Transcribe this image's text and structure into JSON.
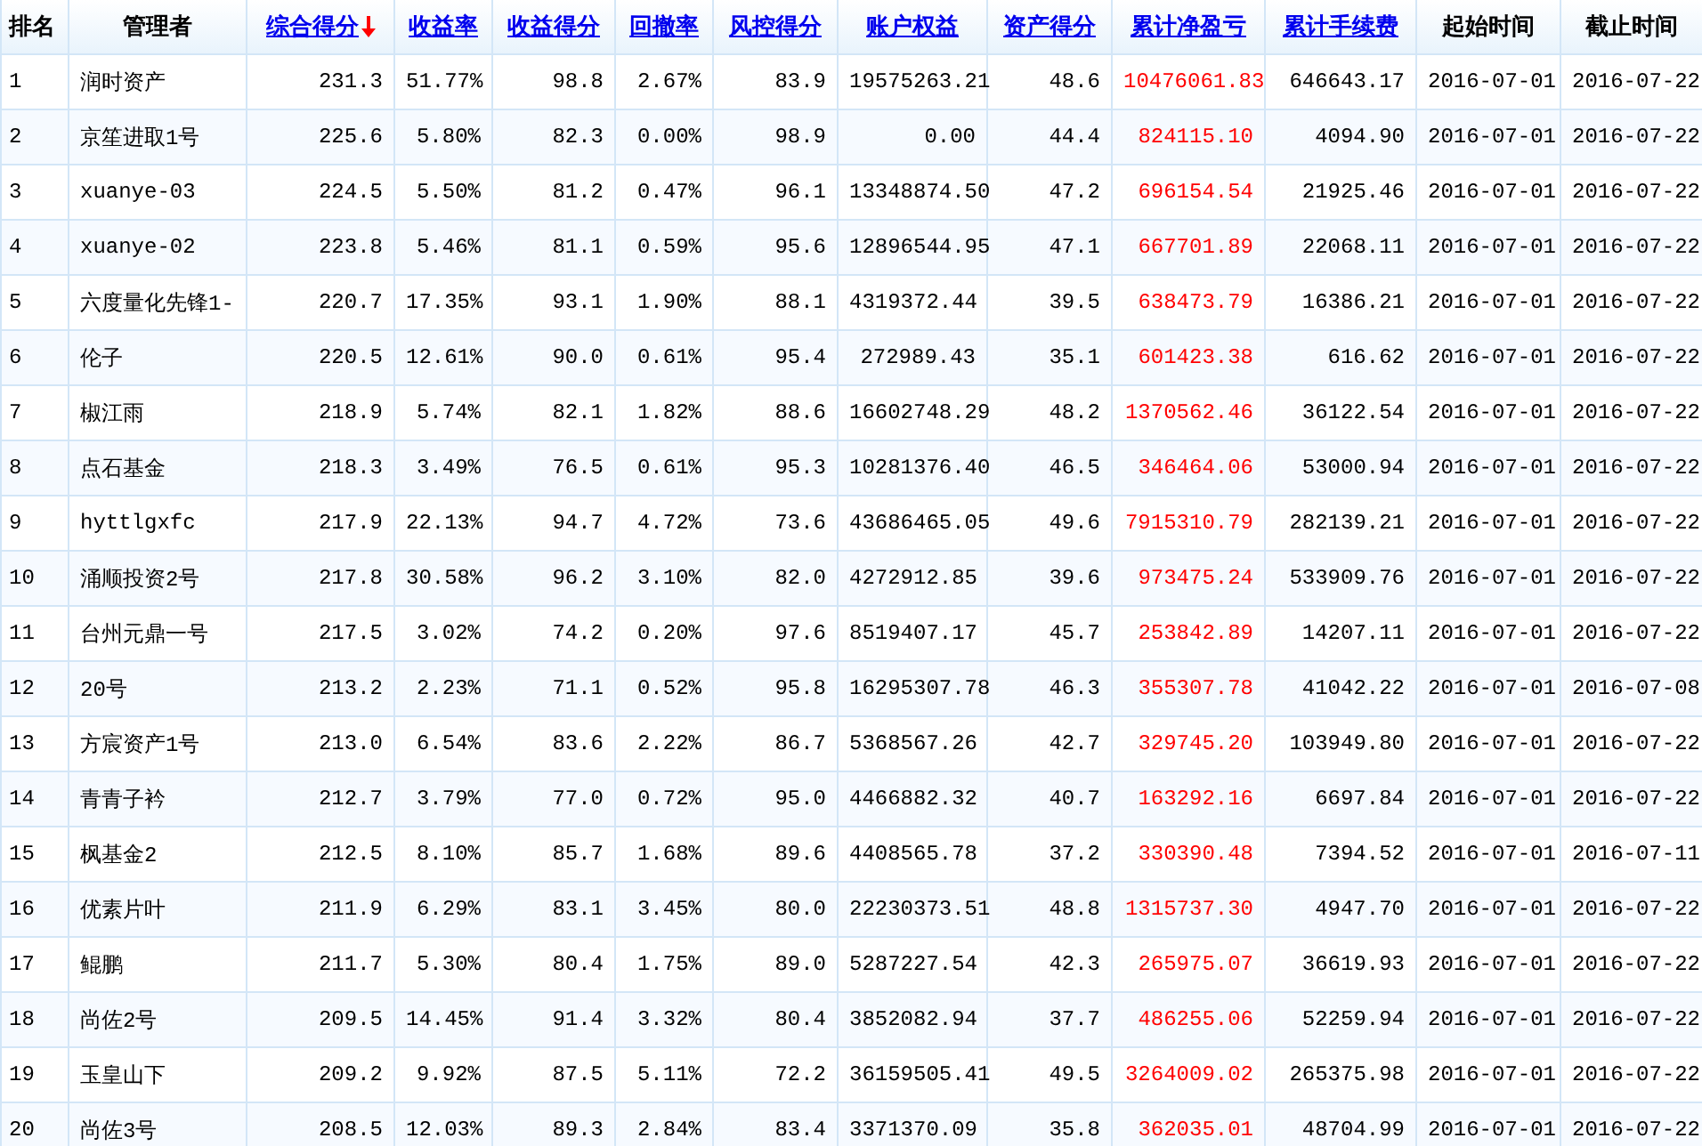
{
  "table": {
    "columns": [
      {
        "label": "排名",
        "kind": "rank",
        "link": false,
        "sorted": false,
        "highlight": false
      },
      {
        "label": "管理者",
        "kind": "text",
        "link": false,
        "sorted": false,
        "highlight": false
      },
      {
        "label": "综合得分",
        "kind": "number",
        "link": true,
        "sorted": true,
        "highlight": false
      },
      {
        "label": "收益率",
        "kind": "number",
        "link": true,
        "sorted": false,
        "highlight": false
      },
      {
        "label": "收益得分",
        "kind": "number",
        "link": true,
        "sorted": false,
        "highlight": false
      },
      {
        "label": "回撤率",
        "kind": "number",
        "link": true,
        "sorted": false,
        "highlight": false
      },
      {
        "label": "风控得分",
        "kind": "number",
        "link": true,
        "sorted": false,
        "highlight": false
      },
      {
        "label": "账户权益",
        "kind": "number",
        "link": true,
        "sorted": false,
        "highlight": false
      },
      {
        "label": "资产得分",
        "kind": "number",
        "link": true,
        "sorted": false,
        "highlight": false
      },
      {
        "label": "累计净盈亏",
        "kind": "number",
        "link": true,
        "sorted": false,
        "highlight": true
      },
      {
        "label": "累计手续费",
        "kind": "number",
        "link": true,
        "sorted": false,
        "highlight": false
      },
      {
        "label": "起始时间",
        "kind": "date",
        "link": false,
        "sorted": false,
        "highlight": false
      },
      {
        "label": "截止时间",
        "kind": "date",
        "link": false,
        "sorted": false,
        "highlight": false
      }
    ],
    "rows": [
      [
        "1",
        "润时资产",
        "231.3",
        "51.77%",
        "98.8",
        "2.67%",
        "83.9",
        "19575263.21",
        "48.6",
        "10476061.83",
        "646643.17",
        "2016-07-01",
        "2016-07-22"
      ],
      [
        "2",
        "京笙进取1号",
        "225.6",
        "5.80%",
        "82.3",
        "0.00%",
        "98.9",
        "0.00",
        "44.4",
        "824115.10",
        "4094.90",
        "2016-07-01",
        "2016-07-22"
      ],
      [
        "3",
        "xuanye-03",
        "224.5",
        "5.50%",
        "81.2",
        "0.47%",
        "96.1",
        "13348874.50",
        "47.2",
        "696154.54",
        "21925.46",
        "2016-07-01",
        "2016-07-22"
      ],
      [
        "4",
        "xuanye-02",
        "223.8",
        "5.46%",
        "81.1",
        "0.59%",
        "95.6",
        "12896544.95",
        "47.1",
        "667701.89",
        "22068.11",
        "2016-07-01",
        "2016-07-22"
      ],
      [
        "5",
        "六度量化先锋1-",
        "220.7",
        "17.35%",
        "93.1",
        "1.90%",
        "88.1",
        "4319372.44",
        "39.5",
        "638473.79",
        "16386.21",
        "2016-07-01",
        "2016-07-22"
      ],
      [
        "6",
        "伦子",
        "220.5",
        "12.61%",
        "90.0",
        "0.61%",
        "95.4",
        "272989.43",
        "35.1",
        "601423.38",
        "616.62",
        "2016-07-01",
        "2016-07-22"
      ],
      [
        "7",
        "椒江雨",
        "218.9",
        "5.74%",
        "82.1",
        "1.82%",
        "88.6",
        "16602748.29",
        "48.2",
        "1370562.46",
        "36122.54",
        "2016-07-01",
        "2016-07-22"
      ],
      [
        "8",
        "点石基金",
        "218.3",
        "3.49%",
        "76.5",
        "0.61%",
        "95.3",
        "10281376.40",
        "46.5",
        "346464.06",
        "53000.94",
        "2016-07-01",
        "2016-07-22"
      ],
      [
        "9",
        "hyttlgxfc",
        "217.9",
        "22.13%",
        "94.7",
        "4.72%",
        "73.6",
        "43686465.05",
        "49.6",
        "7915310.79",
        "282139.21",
        "2016-07-01",
        "2016-07-22"
      ],
      [
        "10",
        "涌顺投资2号",
        "217.8",
        "30.58%",
        "96.2",
        "3.10%",
        "82.0",
        "4272912.85",
        "39.6",
        "973475.24",
        "533909.76",
        "2016-07-01",
        "2016-07-22"
      ],
      [
        "11",
        "台州元鼎一号",
        "217.5",
        "3.02%",
        "74.2",
        "0.20%",
        "97.6",
        "8519407.17",
        "45.7",
        "253842.89",
        "14207.11",
        "2016-07-01",
        "2016-07-22"
      ],
      [
        "12",
        "20号",
        "213.2",
        "2.23%",
        "71.1",
        "0.52%",
        "95.8",
        "16295307.78",
        "46.3",
        "355307.78",
        "41042.22",
        "2016-07-01",
        "2016-07-08"
      ],
      [
        "13",
        "方宸资产1号",
        "213.0",
        "6.54%",
        "83.6",
        "2.22%",
        "86.7",
        "5368567.26",
        "42.7",
        "329745.20",
        "103949.80",
        "2016-07-01",
        "2016-07-22"
      ],
      [
        "14",
        "青青子衿",
        "212.7",
        "3.79%",
        "77.0",
        "0.72%",
        "95.0",
        "4466882.32",
        "40.7",
        "163292.16",
        "6697.84",
        "2016-07-01",
        "2016-07-22"
      ],
      [
        "15",
        "枫基金2",
        "212.5",
        "8.10%",
        "85.7",
        "1.68%",
        "89.6",
        "4408565.78",
        "37.2",
        "330390.48",
        "7394.52",
        "2016-07-01",
        "2016-07-11"
      ],
      [
        "16",
        "优素片叶",
        "211.9",
        "6.29%",
        "83.1",
        "3.45%",
        "80.0",
        "22230373.51",
        "48.8",
        "1315737.30",
        "4947.70",
        "2016-07-01",
        "2016-07-22"
      ],
      [
        "17",
        "鲲鹏",
        "211.7",
        "5.30%",
        "80.4",
        "1.75%",
        "89.0",
        "5287227.54",
        "42.3",
        "265975.07",
        "36619.93",
        "2016-07-01",
        "2016-07-22"
      ],
      [
        "18",
        "尚佐2号",
        "209.5",
        "14.45%",
        "91.4",
        "3.32%",
        "80.4",
        "3852082.94",
        "37.7",
        "486255.06",
        "52259.94",
        "2016-07-01",
        "2016-07-22"
      ],
      [
        "19",
        "玉皇山下",
        "209.2",
        "9.92%",
        "87.5",
        "5.11%",
        "72.2",
        "36159505.41",
        "49.5",
        "3264009.02",
        "265375.98",
        "2016-07-01",
        "2016-07-22"
      ],
      [
        "20",
        "尚佐3号",
        "208.5",
        "12.03%",
        "89.3",
        "2.84%",
        "83.4",
        "3371370.09",
        "35.8",
        "362035.01",
        "48704.99",
        "2016-07-01",
        "2016-07-22"
      ]
    ]
  }
}
